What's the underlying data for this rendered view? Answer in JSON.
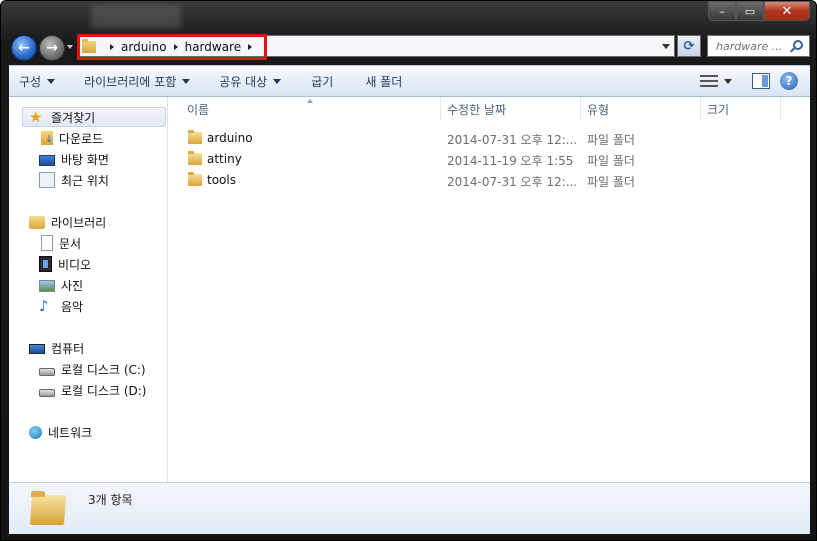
{
  "window": {
    "caption_buttons": [
      "minimize",
      "maximize",
      "close"
    ]
  },
  "address": {
    "crumbs": [
      "arduino",
      "hardware"
    ],
    "search_placeholder": "hardware ..."
  },
  "toolbar": {
    "organize": "구성",
    "include_library": "라이브러리에 포함",
    "share_with": "공유 대상",
    "burn": "굽기",
    "new_folder": "새 폴더"
  },
  "nav": {
    "favorites": "즐겨찾기",
    "downloads": "다운로드",
    "desktop": "바탕 화면",
    "recent": "최근 위치",
    "libraries": "라이브러리",
    "documents": "문서",
    "videos": "비디오",
    "pictures": "사진",
    "music": "음악",
    "computer": "컴퓨터",
    "drive_c": "로컬 디스크 (C:)",
    "drive_d": "로컬 디스크 (D:)",
    "network": "네트워크"
  },
  "columns": {
    "name": "이름",
    "date": "수정한 날짜",
    "type": "유형",
    "size": "크기"
  },
  "files": [
    {
      "name": "arduino",
      "date": "2014-07-31 오후 12:...",
      "type": "파일 폴더"
    },
    {
      "name": "attiny",
      "date": "2014-11-19 오후 1:55",
      "type": "파일 폴더"
    },
    {
      "name": "tools",
      "date": "2014-07-31 오후 12:...",
      "type": "파일 폴더"
    }
  ],
  "details": {
    "item_count": "3개 항목"
  }
}
